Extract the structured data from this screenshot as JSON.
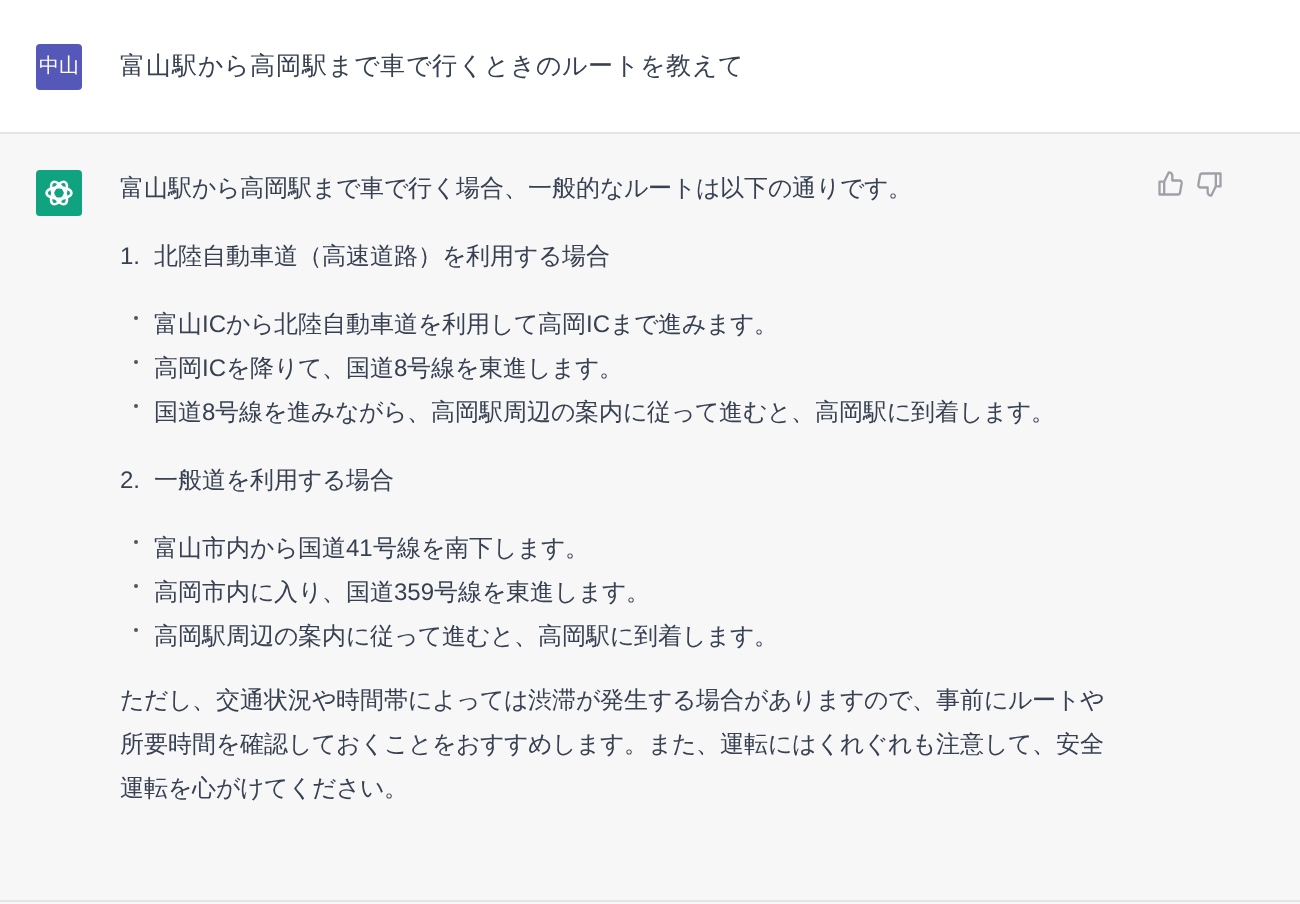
{
  "user": {
    "avatar": "中山",
    "message": "富山駅から高岡駅まで車で行くときのルートを教えて"
  },
  "assistant": {
    "intro": "富山駅から高岡駅まで車で行く場合、一般的なルートは以下の通りです。",
    "sections": [
      {
        "number": "1.",
        "title": "北陸自動車道（高速道路）を利用する場合",
        "bullets": [
          "富山ICから北陸自動車道を利用して高岡ICまで進みます。",
          "高岡ICを降りて、国道8号線を東進します。",
          "国道8号線を進みながら、高岡駅周辺の案内に従って進むと、高岡駅に到着します。"
        ]
      },
      {
        "number": "2.",
        "title": "一般道を利用する場合",
        "bullets": [
          "富山市内から国道41号線を南下します。",
          "高岡市内に入り、国道359号線を東進します。",
          "高岡駅周辺の案内に従って進むと、高岡駅に到着します。"
        ]
      }
    ],
    "closing": "ただし、交通状況や時間帯によっては渋滞が発生する場合がありますので、事前にルートや所要時間を確認しておくことをおすすめします。また、運転にはくれぐれも注意して、安全運転を心がけてください。"
  }
}
